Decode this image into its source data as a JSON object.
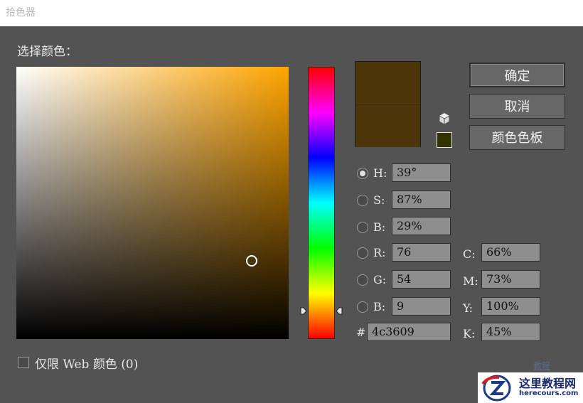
{
  "window": {
    "title": "拾色器"
  },
  "picker": {
    "label": "选择颜色：",
    "field_hue_color": "#ffa400"
  },
  "swatches": {
    "new_color": "#4c3609",
    "current_color": "#4c3609",
    "websafe_color": "#333300"
  },
  "buttons": {
    "ok": "确定",
    "cancel": "取消",
    "swatches": "颜色色板"
  },
  "hsb": [
    {
      "label": "H:",
      "value": "39°",
      "checked": true
    },
    {
      "label": "S:",
      "value": "87%",
      "checked": false
    },
    {
      "label": "B:",
      "value": "29%",
      "checked": false
    }
  ],
  "rgb": [
    {
      "label": "R:",
      "value": "76",
      "checked": false
    },
    {
      "label": "G:",
      "value": "54",
      "checked": false
    },
    {
      "label": "B:",
      "value": "9",
      "checked": false
    }
  ],
  "hex": {
    "label": "#",
    "value": "4c3609"
  },
  "cmyk": [
    {
      "label": "C:",
      "value": "66%"
    },
    {
      "label": "M:",
      "value": "73%"
    },
    {
      "label": "Y:",
      "value": "100%"
    },
    {
      "label": "K:",
      "value": "45%"
    }
  ],
  "options": {
    "web_only_label": "仅限 Web 颜色 (0)",
    "web_only_checked": false
  },
  "watermark": {
    "title": "这里教程网",
    "url": "herecours.com",
    "faint_text": "教程"
  }
}
